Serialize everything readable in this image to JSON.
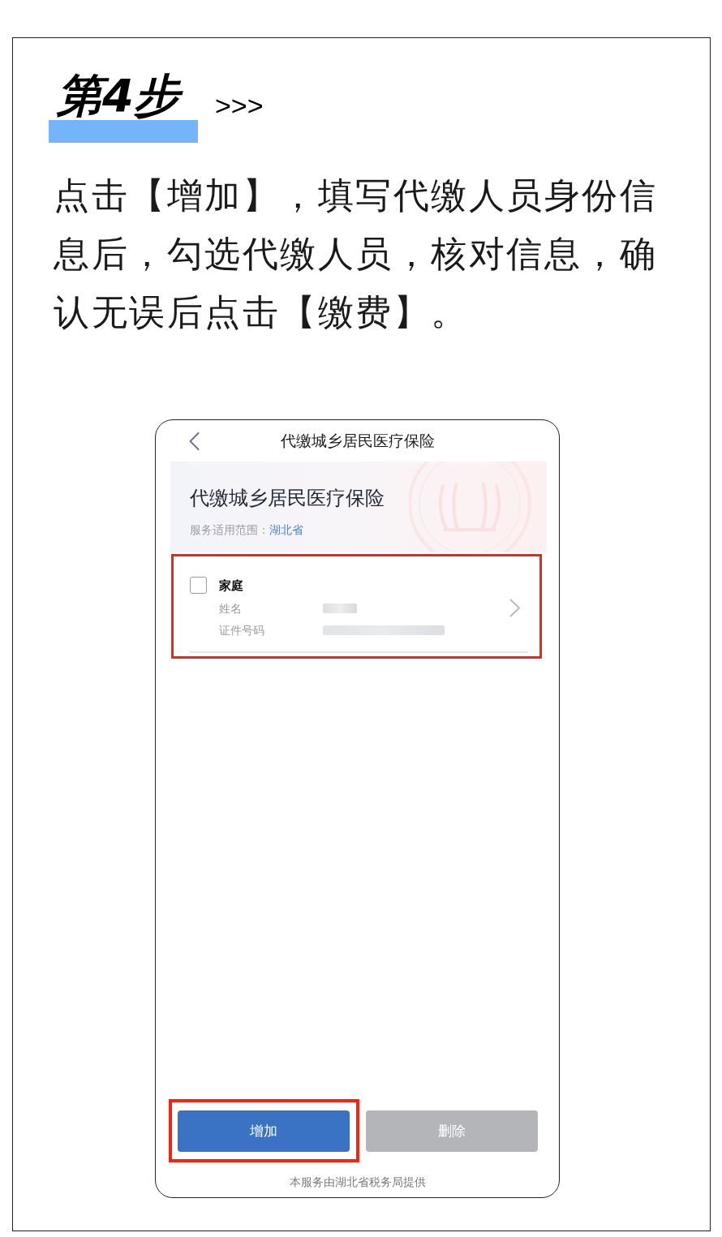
{
  "step": {
    "title": "第4步",
    "arrows": ">>>"
  },
  "instruction": "点击【增加】，填写代缴人员身份信息后，勾选代缴人员，核对信息，确认无误后点击【缴费】。",
  "phone": {
    "nav_title": "代缴城乡居民医疗保险",
    "banner": {
      "title": "代缴城乡居民医疗保险",
      "scope_label": "服务适用范围：",
      "scope_value": "湖北省"
    },
    "members": [
      {
        "group": "家庭",
        "checked": false,
        "highlighted": true,
        "fields": [
          {
            "label": "姓名",
            "redacted": true
          },
          {
            "label": "证件号码",
            "redacted": true
          }
        ]
      }
    ],
    "buttons": [
      {
        "label": "增加",
        "disabled": false,
        "highlighted": true
      },
      {
        "label": "删除",
        "disabled": true,
        "highlighted": false
      }
    ],
    "footer": "本服务由湖北省税务局提供"
  }
}
